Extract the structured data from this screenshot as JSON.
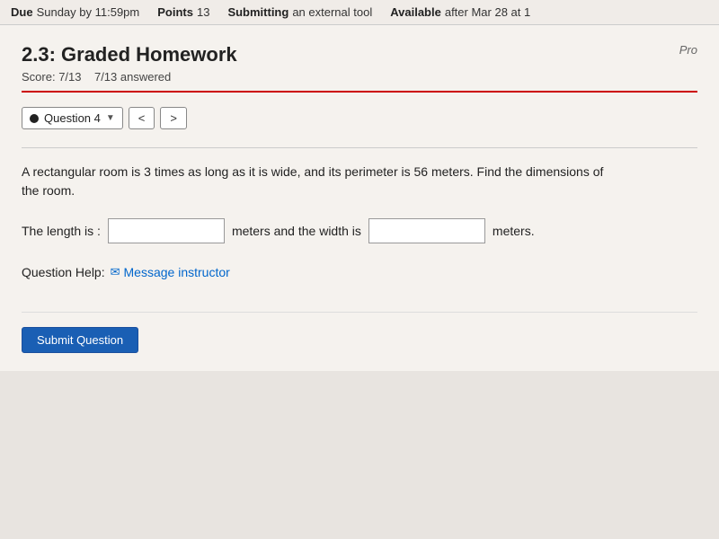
{
  "topbar": {
    "due_label": "Due",
    "due_value": "Sunday by 11:59pm",
    "points_label": "Points",
    "points_value": "13",
    "submitting_label": "Submitting",
    "submitting_value": "an external tool",
    "available_label": "Available",
    "available_value": "after Mar 28 at 1"
  },
  "assignment": {
    "title": "2.3: Graded Homework",
    "score_label": "Score:",
    "score_value": "7/13",
    "answered_value": "7/13 answered",
    "pro_label": "Pro"
  },
  "question_selector": {
    "dot_color": "#222",
    "label": "Question 4",
    "prev_label": "<",
    "next_label": ">"
  },
  "question": {
    "text_line1": "A rectangular room is 3 times as long as it is wide, and its perimeter is 56 meters. Find the dimensions of",
    "text_line2": "the room.",
    "length_prefix": "The length is :",
    "length_placeholder": "",
    "length_suffix": "meters and the width is",
    "width_placeholder": "",
    "width_suffix": "meters.",
    "help_label": "Question Help:",
    "message_instructor_label": "Message instructor",
    "submit_label": "Submit Question"
  }
}
